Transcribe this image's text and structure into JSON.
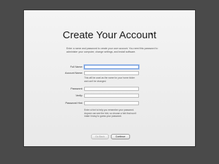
{
  "page": {
    "title": "Create Your Account",
    "intro": "Enter a name and password to create your user account. You need this password to administer your computer, change settings, and install software."
  },
  "form": {
    "full_name_label": "Full Name:",
    "account_name_label": "Account Name:",
    "account_name_help": "This will be used as the name for your home folder and can't be changed.",
    "password_label": "Password:",
    "verify_label": "Verify:",
    "password_hint_label": "Password Hint:",
    "password_hint_help": "Enter a hint to help you remember your password. Anyone can see the hint, so choose a hint that won't make it easy to guess your password.",
    "full_name_value": "",
    "account_name_value": "",
    "password_value": "",
    "verify_value": "",
    "password_hint_value": ""
  },
  "buttons": {
    "back_label": "Go Back",
    "continue_label": "Continue"
  }
}
